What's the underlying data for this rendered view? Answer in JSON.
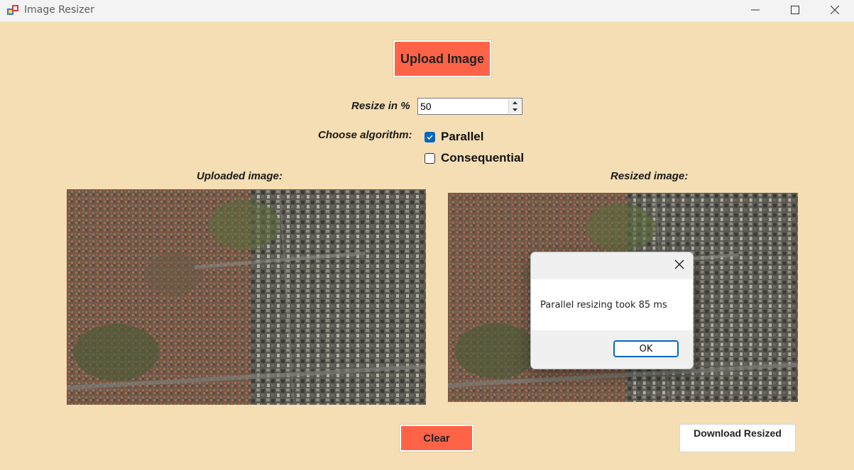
{
  "window": {
    "title": "Image Resizer",
    "icon": "app-icon"
  },
  "controls": {
    "upload_label": "Upload Image",
    "resize_label": "Resize in %",
    "resize_value": "50",
    "algorithm_label": "Choose algorithm:",
    "options": [
      {
        "label": "Parallel",
        "checked": true
      },
      {
        "label": "Consequential",
        "checked": false
      }
    ]
  },
  "images": {
    "uploaded_label": "Uploaded image:",
    "resized_label": "Resized image:"
  },
  "buttons": {
    "clear_label": "Clear",
    "download_label": "Download Resized"
  },
  "dialog": {
    "message": "Parallel resizing took 85 ms",
    "ok_label": "OK"
  },
  "colors": {
    "background": "#f5deb3",
    "accent_button": "#ff6347",
    "checkbox_checked": "#0067c0"
  }
}
